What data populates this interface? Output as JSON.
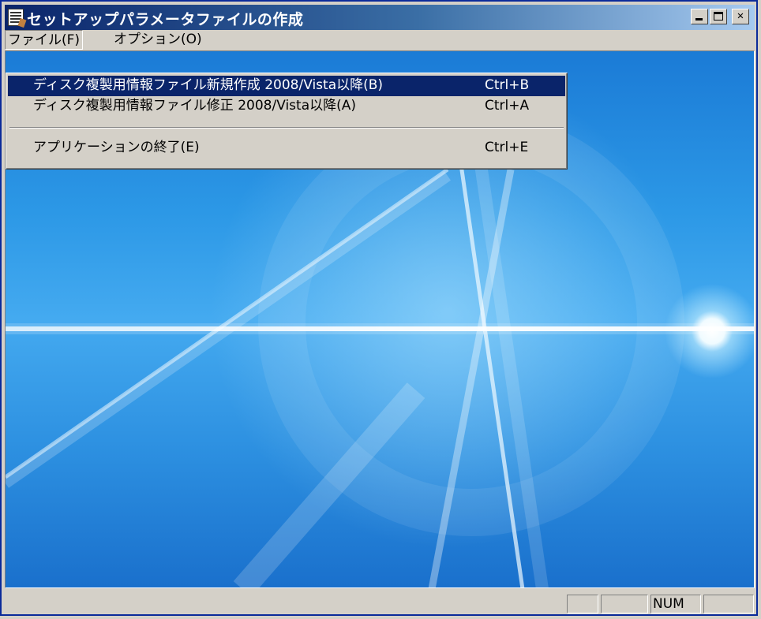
{
  "window": {
    "title": "セットアップパラメータファイルの作成",
    "caption_buttons": {
      "minimize": "_",
      "maximize": "□",
      "close": "✕"
    }
  },
  "menubar": {
    "items": [
      {
        "label": "ファイル(F)"
      },
      {
        "label": "オプション(O)"
      }
    ]
  },
  "file_menu": {
    "items": [
      {
        "label": "ディスク複製用情報ファイル新規作成 2008/Vista以降(B)",
        "shortcut": "Ctrl+B"
      },
      {
        "label": "ディスク複製用情報ファイル修正 2008/Vista以降(A)",
        "shortcut": "Ctrl+A"
      },
      {
        "label": "アプリケーションの終了(E)",
        "shortcut": "Ctrl+E"
      }
    ]
  },
  "statusbar": {
    "panes": [
      "",
      "",
      "NUM",
      ""
    ]
  },
  "colors": {
    "titlebar_start": "#0a246a",
    "titlebar_end": "#a6caf0",
    "menu_highlight": "#0a246a",
    "background_blue": "#2c98e6"
  }
}
